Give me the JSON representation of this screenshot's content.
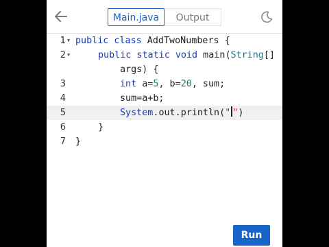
{
  "header": {
    "back_icon": "arrow-left-icon",
    "tabs": [
      {
        "label": "Main.java",
        "active": true
      },
      {
        "label": "Output",
        "active": false
      }
    ],
    "theme_icon": "moon-icon"
  },
  "editor": {
    "active_line": 5,
    "lines": [
      {
        "number": "1",
        "fold": true
      },
      {
        "number": "2",
        "fold": true
      },
      {
        "number": "3",
        "fold": false
      },
      {
        "number": "4",
        "fold": false
      },
      {
        "number": "5",
        "fold": false
      },
      {
        "number": "6",
        "fold": false
      },
      {
        "number": "7",
        "fold": false
      }
    ],
    "tokens": {
      "l1": {
        "kw": "public class",
        "name": " AddTwoNumbers {"
      },
      "l2": {
        "kw": "public static void",
        "name": " main",
        "open": "(",
        "cls": "String",
        "br": "[]"
      },
      "l2b": {
        "args": "args) {"
      },
      "l3": {
        "kw": "int",
        "a": " a=",
        "n1": "5",
        "b": ", b=",
        "n2": "20",
        "rest": ", sum;"
      },
      "l4": {
        "text": "sum=a+b;"
      },
      "l5": {
        "obj": "System",
        "dot1": ".",
        "out": "out",
        "dot2": ".",
        "fn": "println",
        "open": "(",
        "q1": "\"",
        "q2": "\"",
        "close": ")"
      },
      "l6": {
        "text": "}"
      },
      "l7": {
        "text": "}"
      }
    }
  },
  "actions": {
    "run_label": "Run"
  },
  "colors": {
    "accent": "#1766c7",
    "keyword": "#1a3ab0",
    "number": "#158a55",
    "string": "#b0341d",
    "active_line_bg": "#f0f0f0"
  }
}
